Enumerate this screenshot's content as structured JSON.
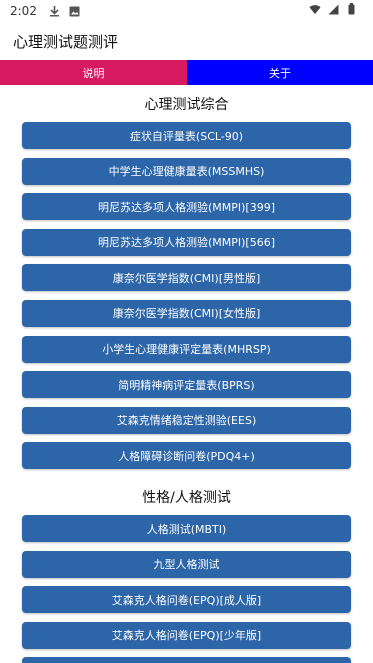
{
  "status_bar": {
    "time": "2:02",
    "left_icons": [
      "download-icon",
      "image-icon"
    ],
    "right_icons": [
      "wifi-icon",
      "signal-icon",
      "battery-icon"
    ]
  },
  "app": {
    "title": "心理测试题测评"
  },
  "tabs": {
    "intro": "说明",
    "about": "关于"
  },
  "colors": {
    "intro_tab": "#d81b60",
    "about_tab": "#0000ff",
    "button": "#2d65a9"
  },
  "sections": [
    {
      "title": "心理测试综合",
      "items": [
        "症状自评量表(SCL-90)",
        "中学生心理健康量表(MSSMHS)",
        "明尼苏达多项人格测验(MMPI)[399]",
        "明尼苏达多项人格测验(MMPI)[566]",
        "康奈尔医学指数(CMI)[男性版]",
        "康奈尔医学指数(CMI)[女性版]",
        "小学生心理健康评定量表(MHRSP)",
        "简明精神病评定量表(BPRS)",
        "艾森克情绪稳定性测验(EES)",
        "人格障碍诊断问卷(PDQ4+)"
      ]
    },
    {
      "title": "性格/人格测试",
      "items": [
        "人格测试(MBTI)",
        "九型人格测试",
        "艾森克人格问卷(EPQ)[成人版]",
        "艾森克人格问卷(EPQ)[少年版]"
      ]
    }
  ]
}
